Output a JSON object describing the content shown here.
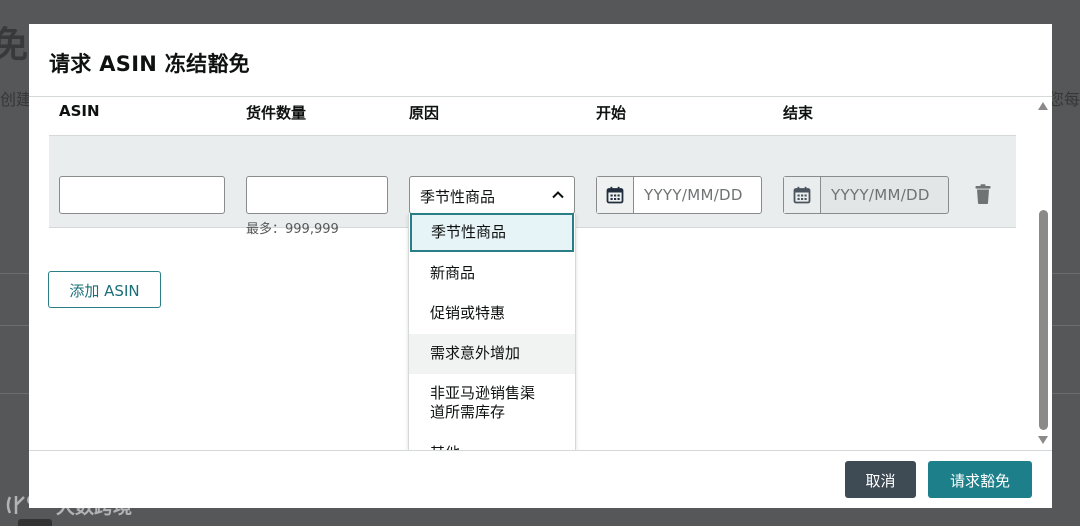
{
  "background": {
    "title_fragment": "免",
    "left_fragment": "创建",
    "right_fragment": "您每"
  },
  "modal": {
    "title": "请求 ASIN 冻结豁免",
    "columns": {
      "asin": "ASIN",
      "quantity": "货件数量",
      "reason": "原因",
      "start": "开始",
      "end": "结束"
    },
    "row": {
      "asin_value": "",
      "quantity_value": "",
      "quantity_hint": "最多：999,999",
      "reason_selected": "季节性商品",
      "start_placeholder": "YYYY/MM/DD",
      "end_placeholder": "YYYY/MM/DD",
      "end_disabled": true,
      "calendar_icon": "calendar-icon",
      "delete_icon": "trash-icon"
    },
    "reason_options": [
      "季节性商品",
      "新商品",
      "促销或特惠",
      "需求意外增加",
      "非亚马逊销售渠道所需库存",
      "其他"
    ],
    "reason_option_lines": {
      "line1": "非亚马逊销售渠",
      "line2": "道所需库存"
    },
    "add_asin_label": "添加 ASIN",
    "cancel_label": "取消",
    "submit_label": "请求豁免"
  },
  "colors": {
    "primary": "#1d7f8a",
    "secondary": "#3e4a54",
    "selected_bg": "#e6f4f7",
    "row_band": "#eaeded"
  },
  "watermark": "大数跨境"
}
